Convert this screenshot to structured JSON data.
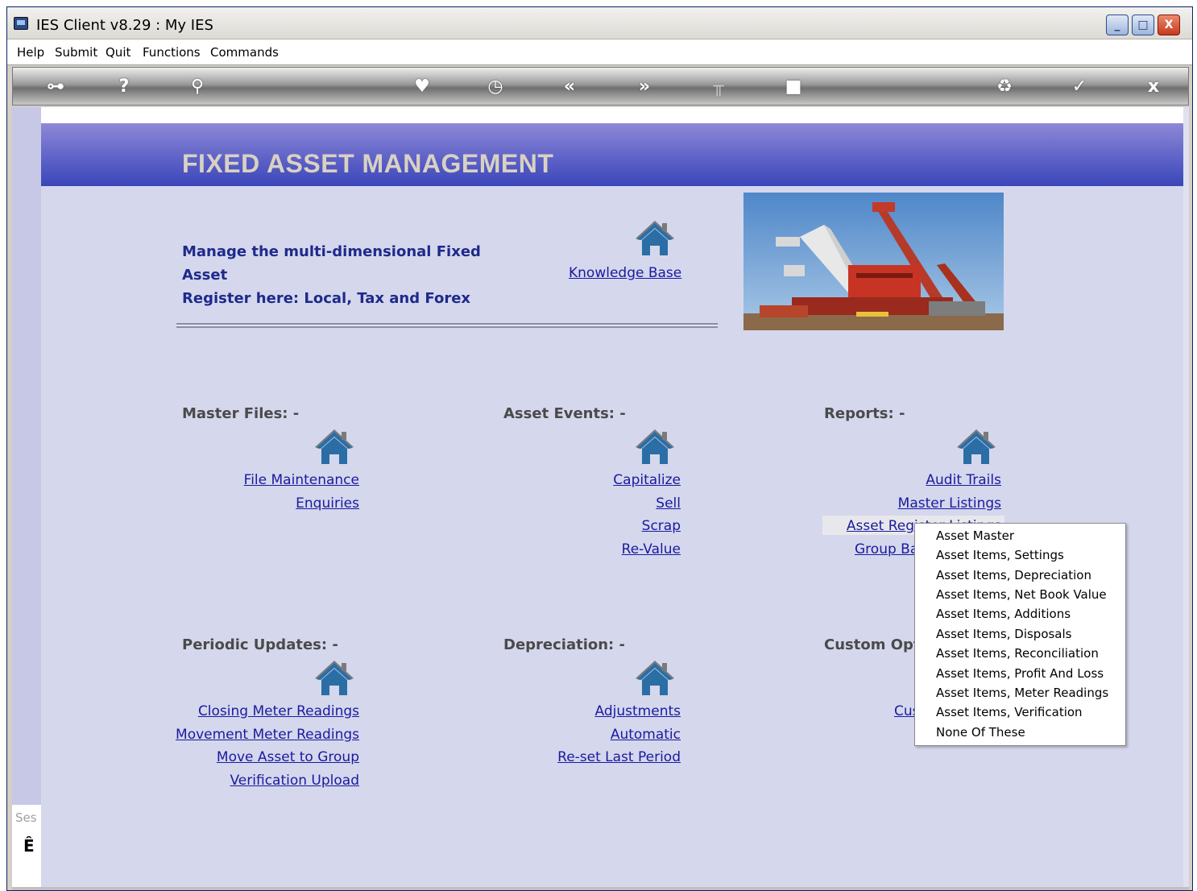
{
  "window": {
    "title": "IES Client v8.29 : My IES",
    "minimize_glyph": "_",
    "maximize_glyph": "□",
    "close_glyph": "X"
  },
  "menu": {
    "items": [
      "Help",
      "Submit",
      "Quit",
      "Functions",
      "Commands"
    ]
  },
  "toolbar": {
    "icons": [
      {
        "name": "key-icon",
        "glyph": "⊶"
      },
      {
        "name": "help-icon",
        "glyph": "?"
      },
      {
        "name": "search-icon",
        "glyph": "⚲"
      },
      {
        "name": "heart-icon",
        "glyph": "♥"
      },
      {
        "name": "clock-icon",
        "glyph": "◷"
      },
      {
        "name": "rewind-icon",
        "glyph": "«"
      },
      {
        "name": "forward-icon",
        "glyph": "»"
      },
      {
        "name": "tool-icon",
        "glyph": "╥"
      },
      {
        "name": "stop-icon",
        "glyph": "■"
      },
      {
        "name": "recycle-icon",
        "glyph": "♻"
      },
      {
        "name": "check-icon",
        "glyph": "✓"
      },
      {
        "name": "close-icon",
        "glyph": "x"
      }
    ]
  },
  "side": {
    "session_label": "Ses",
    "glyph": "Ê"
  },
  "banner": {
    "title": "FIXED ASSET MANAGEMENT"
  },
  "intro": {
    "line1": "Manage the multi-dimensional Fixed Asset",
    "line2": "Register here: Local, Tax and Forex",
    "knowledge_base": "Knowledge Base"
  },
  "sections": {
    "master_files": {
      "heading": "Master Files: -",
      "links": [
        "File Maintenance",
        "Enquiries"
      ]
    },
    "asset_events": {
      "heading": "Asset Events: -",
      "links": [
        "Capitalize",
        "Sell",
        "Scrap",
        "Re-Value"
      ]
    },
    "reports": {
      "heading": "Reports: -",
      "links": [
        "Audit Trails",
        "Master Listings",
        "Asset Register Listings",
        "Group Bal"
      ]
    },
    "periodic_updates": {
      "heading": "Periodic Updates: -",
      "links": [
        "Closing Meter Readings",
        "Movement Meter Readings",
        "Move Asset to Group",
        "Verification Upload"
      ]
    },
    "depreciation": {
      "heading": "Depreciation: -",
      "links": [
        "Adjustments",
        "Automatic",
        "Re-set Last Period"
      ]
    },
    "custom_options": {
      "heading": "Custom Optio",
      "links": [
        "Cus"
      ]
    }
  },
  "dropdown": {
    "items": [
      "Asset Master",
      "Asset Items, Settings",
      "Asset Items, Depreciation",
      "Asset Items, Net Book Value",
      "Asset Items, Additions",
      "Asset Items, Disposals",
      "Asset Items, Reconciliation",
      "Asset Items, Profit And Loss",
      "Asset Items, Meter Readings",
      "Asset Items, Verification",
      "None Of These"
    ]
  },
  "colors": {
    "banner": "#5f63c8",
    "panel": "#d5d7ed",
    "link": "#1a1a9e",
    "intro": "#1e2a8a",
    "house": "#2b6ea6"
  }
}
